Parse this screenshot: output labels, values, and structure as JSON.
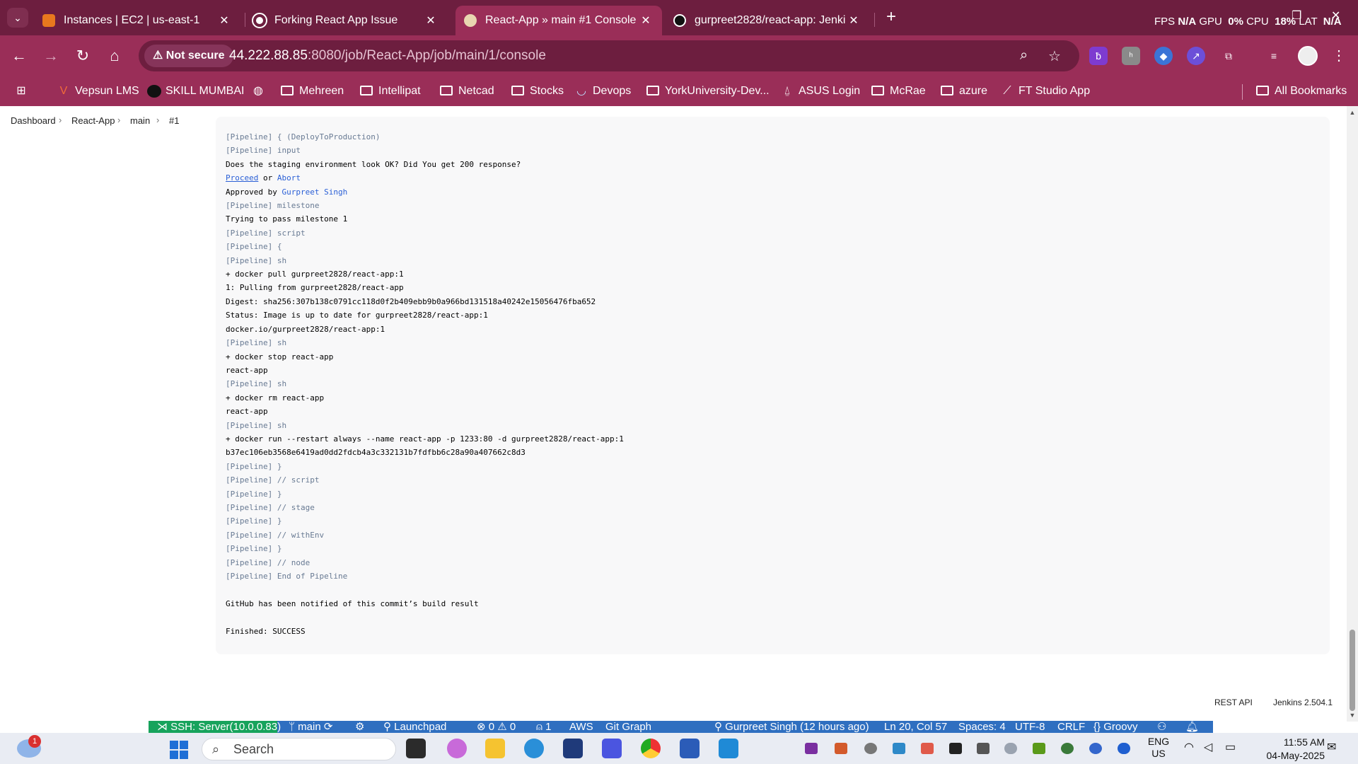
{
  "browser": {
    "tabs": [
      {
        "title": "Instances | EC2 | us-east-1",
        "active": false
      },
      {
        "title": "Forking React App Issue",
        "active": false
      },
      {
        "title": "React-App » main #1 Console ",
        "active": true
      },
      {
        "title": "gurpreet2828/react-app: Jenkin",
        "active": false
      }
    ],
    "perf": {
      "fps_label": "FPS",
      "fps_value": "N/A",
      "gpu_label": "GPU",
      "gpu_value": "0%",
      "cpu_label": "CPU",
      "cpu_value": "18%",
      "lat_label": "LAT",
      "lat_value": "N/A"
    },
    "not_secure": "Not secure",
    "url_host": "44.222.88.85",
    "url_rest": ":8080/job/React-App/job/main/1/console",
    "bookmarks": [
      "Vepsun LMS",
      "SKILL MUMBAI",
      "Mehreen",
      "Intellipat",
      "Netcad",
      "Stocks",
      "Devops",
      "YorkUniversity-Dev...",
      "ASUS Login",
      "McRae",
      "azure",
      "FT Studio App"
    ],
    "all_bookmarks": "All Bookmarks"
  },
  "breadcrumb": [
    "Dashboard",
    "React-App",
    "main",
    "#1"
  ],
  "console": {
    "lines": [
      {
        "t": "[Pipeline] { (DeployToProduction)",
        "k": "pl"
      },
      {
        "t": "[Pipeline] input",
        "k": "pl"
      },
      {
        "t": "Does the staging environment look OK? Did You get 200 response?",
        "k": "out"
      },
      {
        "t": "",
        "k": "proceed"
      },
      {
        "t": "",
        "k": "approved"
      },
      {
        "t": "[Pipeline] milestone",
        "k": "pl"
      },
      {
        "t": "Trying to pass milestone 1",
        "k": "out"
      },
      {
        "t": "[Pipeline] script",
        "k": "pl"
      },
      {
        "t": "[Pipeline] {",
        "k": "pl"
      },
      {
        "t": "[Pipeline] sh",
        "k": "pl"
      },
      {
        "t": "+ docker pull gurpreet2828/react-app:1",
        "k": "out"
      },
      {
        "t": "1: Pulling from gurpreet2828/react-app",
        "k": "out"
      },
      {
        "t": "Digest: sha256:307b138c0791cc118d0f2b409ebb9b0a966bd131518a40242e15056476fba652",
        "k": "out"
      },
      {
        "t": "Status: Image is up to date for gurpreet2828/react-app:1",
        "k": "out"
      },
      {
        "t": "docker.io/gurpreet2828/react-app:1",
        "k": "out"
      },
      {
        "t": "[Pipeline] sh",
        "k": "pl"
      },
      {
        "t": "+ docker stop react-app",
        "k": "out"
      },
      {
        "t": "react-app",
        "k": "out"
      },
      {
        "t": "[Pipeline] sh",
        "k": "pl"
      },
      {
        "t": "+ docker rm react-app",
        "k": "out"
      },
      {
        "t": "react-app",
        "k": "out"
      },
      {
        "t": "[Pipeline] sh",
        "k": "pl"
      },
      {
        "t": "+ docker run --restart always --name react-app -p 1233:80 -d gurpreet2828/react-app:1",
        "k": "out"
      },
      {
        "t": "b37ec106eb3568e6419ad0dd2fdcb4a3c332131b7fdfbb6c28a90a407662c8d3",
        "k": "out"
      },
      {
        "t": "[Pipeline] }",
        "k": "pl"
      },
      {
        "t": "[Pipeline] // script",
        "k": "pl"
      },
      {
        "t": "[Pipeline] }",
        "k": "pl"
      },
      {
        "t": "[Pipeline] // stage",
        "k": "pl"
      },
      {
        "t": "[Pipeline] }",
        "k": "pl"
      },
      {
        "t": "[Pipeline] // withEnv",
        "k": "pl"
      },
      {
        "t": "[Pipeline] }",
        "k": "pl"
      },
      {
        "t": "[Pipeline] // node",
        "k": "pl"
      },
      {
        "t": "[Pipeline] End of Pipeline",
        "k": "pl"
      },
      {
        "t": "",
        "k": "out"
      },
      {
        "t": "GitHub has been notified of this commit’s build result",
        "k": "out"
      },
      {
        "t": "",
        "k": "out"
      },
      {
        "t": "Finished: SUCCESS",
        "k": "out"
      }
    ],
    "proceed_link": "Proceed",
    "or_text": " or ",
    "abort_link": "Abort",
    "approved_prefix": "Approved by ",
    "approver": "Gurpreet Singh"
  },
  "footer": {
    "rest_api": "REST API",
    "version": "Jenkins 2.504.1"
  },
  "vscode_status": {
    "remote": "SSH: Server(10.0.0.83)",
    "branch": "main",
    "launchpad": "Launchpad",
    "problems": "0",
    "warnings": "0",
    "ports": "1",
    "aws": "AWS",
    "git_graph": "Git Graph",
    "blame": "Gurpreet Singh (12 hours ago)",
    "position": "Ln 20, Col 57",
    "spaces": "Spaces: 4",
    "encoding": "UTF-8",
    "eol": "CRLF",
    "language": "Groovy"
  },
  "taskbar": {
    "notification_count": "1",
    "search_placeholder": "Search",
    "lang_top": "ENG",
    "lang_bottom": "US",
    "time": "11:55 AM",
    "date": "04-May-2025"
  },
  "icons": {
    "back": "arrow-left-icon",
    "forward": "arrow-right-icon",
    "reload": "reload-icon",
    "home": "home-icon",
    "zoom": "magnifier-icon",
    "star": "star-icon",
    "extensions": "puzzle-icon",
    "menu": "kebab-icon"
  }
}
